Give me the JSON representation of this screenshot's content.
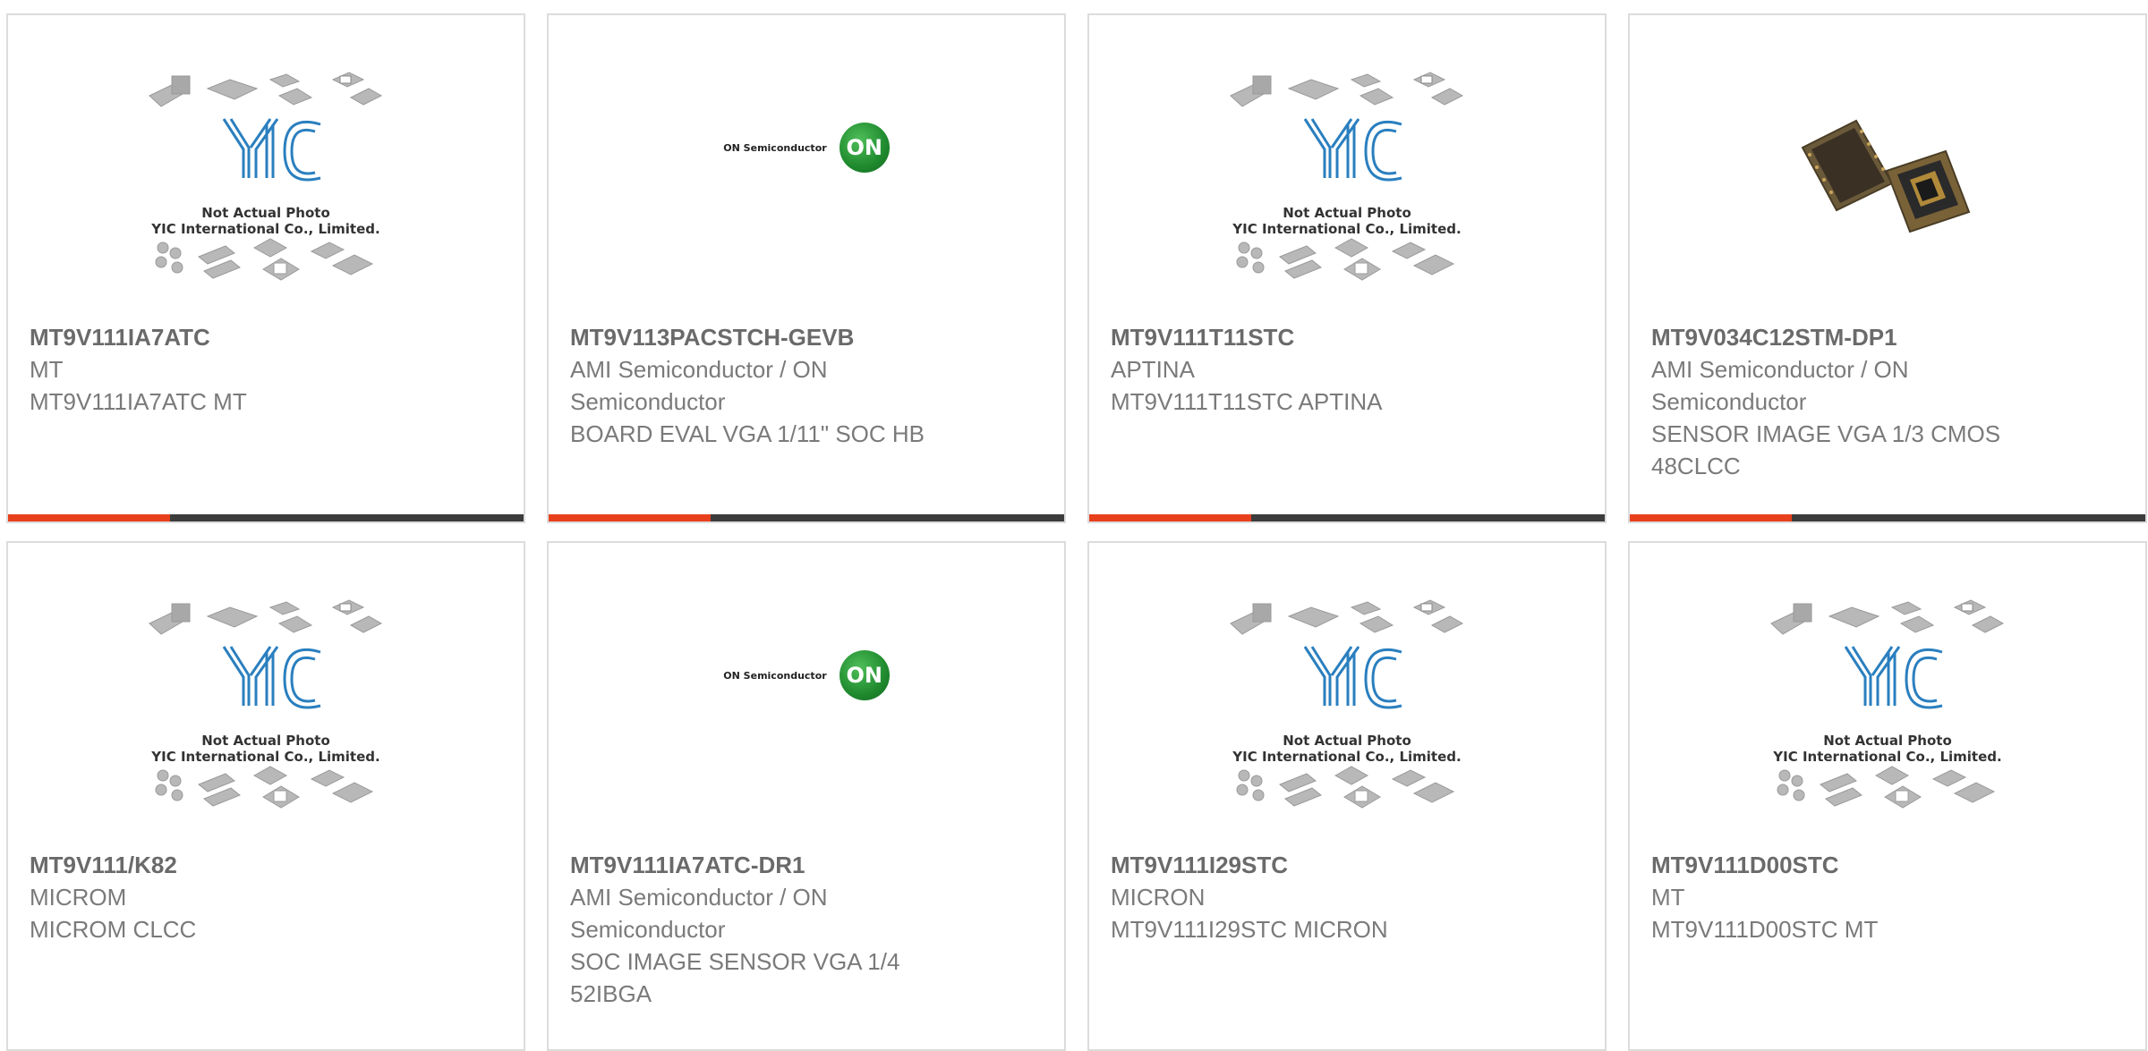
{
  "accent_color": "#e8401c",
  "bar_color": "#3c3c3c",
  "placeholder": {
    "line1": "Not Actual Photo",
    "line2": "YIC International Co., Limited."
  },
  "on_logo": {
    "text": "ON Semiconductor",
    "ball": "ON"
  },
  "products": [
    {
      "part": "MT9V111IA7ATC",
      "manufacturer": "MT",
      "description": "MT9V111IA7ATC MT",
      "image": "yic-placeholder-image"
    },
    {
      "part": "MT9V113PACSTCH-GEVB",
      "manufacturer": "AMI Semiconductor / ON Semiconductor",
      "description": "BOARD EVAL VGA 1/11\" SOC HB",
      "image": "on-semiconductor-logo"
    },
    {
      "part": "MT9V111T11STC",
      "manufacturer": "APTINA",
      "description": "MT9V111T11STC APTINA",
      "image": "yic-placeholder-image"
    },
    {
      "part": "MT9V034C12STM-DP1",
      "manufacturer": "AMI Semiconductor / ON Semiconductor",
      "description": "SENSOR IMAGE VGA 1/3 CMOS 48CLCC",
      "image": "image-sensor-chip-photo"
    },
    {
      "part": "MT9V111/K82",
      "manufacturer": "MICROM",
      "description": "MICROM CLCC",
      "image": "yic-placeholder-image"
    },
    {
      "part": "MT9V111IA7ATC-DR1",
      "manufacturer": "AMI Semiconductor / ON Semiconductor",
      "description": "SOC IMAGE SENSOR VGA 1/4 52IBGA",
      "image": "on-semiconductor-logo"
    },
    {
      "part": "MT9V111I29STC",
      "manufacturer": "MICRON",
      "description": "MT9V111I29STC MICRON",
      "image": "yic-placeholder-image"
    },
    {
      "part": "MT9V111D00STC",
      "manufacturer": "MT",
      "description": "MT9V111D00STC MT",
      "image": "yic-placeholder-image"
    }
  ]
}
